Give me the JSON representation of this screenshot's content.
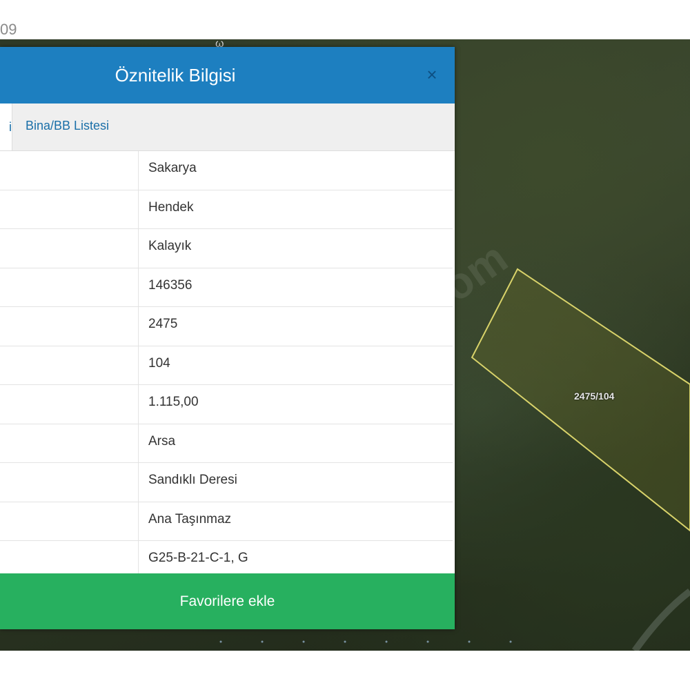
{
  "top_label": "09",
  "map": {
    "road_label": "ω",
    "watermark": "om",
    "parcel_label": "2475/104"
  },
  "panel": {
    "title": "Öznitelik Bilgisi",
    "close_glyph": "×",
    "tabs": {
      "active_partial": "i",
      "second": "Bina/BB Listesi"
    },
    "rows": [
      {
        "value": "Sakarya"
      },
      {
        "value": "Hendek"
      },
      {
        "value": "Kalayık"
      },
      {
        "value": "146356"
      },
      {
        "value": "2475"
      },
      {
        "value": "104"
      },
      {
        "value": "1.115,00"
      },
      {
        "value": "Arsa"
      },
      {
        "value": "Sandıklı Deresi"
      },
      {
        "value": "Ana Taşınmaz"
      },
      {
        "value": "G25-B-21-C-1, G"
      }
    ],
    "favorite_button": "Favorilere ekle"
  },
  "colors": {
    "header": "#1d7fc0",
    "button": "#27b05f",
    "tab_text": "#1a6fa8",
    "parcel_outline": "#d9d36a"
  }
}
